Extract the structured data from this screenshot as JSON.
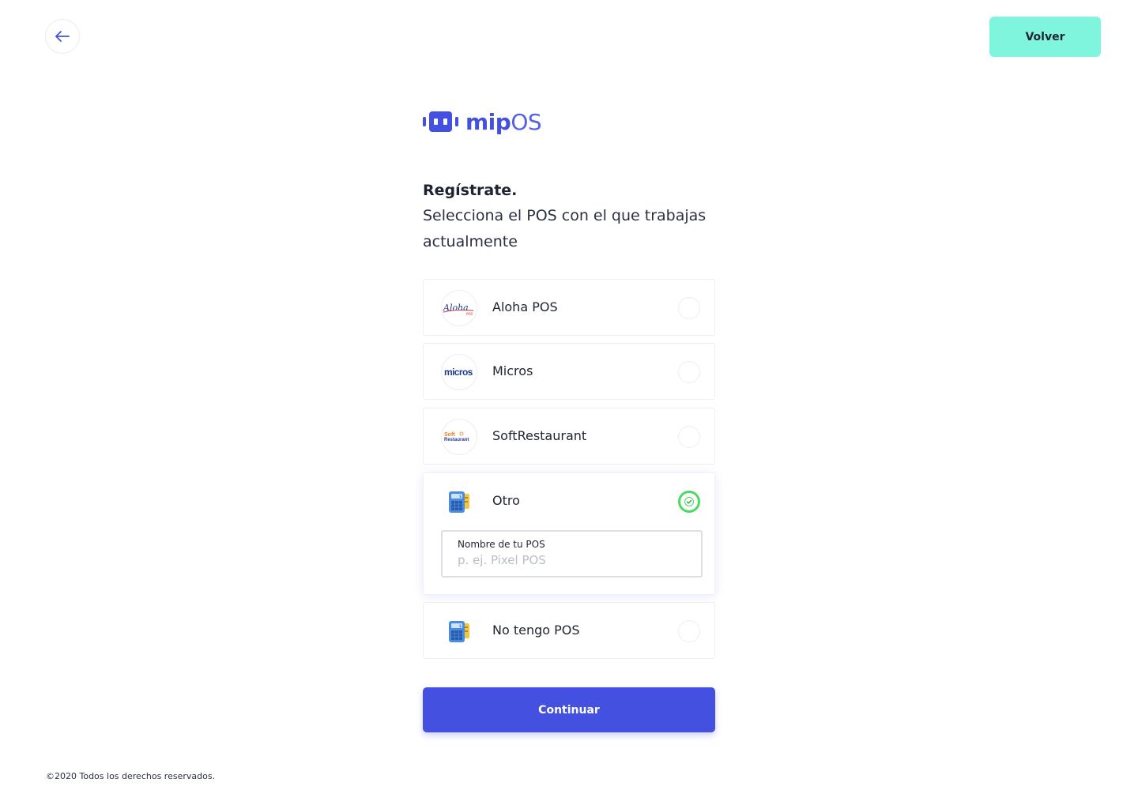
{
  "header": {
    "back_icon": "arrow-left-icon",
    "volver_label": "Volver"
  },
  "brand": {
    "logo_icon": "pos-terminal-icon",
    "name_bold": "mip",
    "name_light": "OS"
  },
  "heading": {
    "title": "Regístrate.",
    "subtitle": "Selecciona el POS con el que trabajas actualmente"
  },
  "options": [
    {
      "label": "Aloha POS",
      "logo_text": "Aloha",
      "logo_subtext": "POS",
      "selected": false
    },
    {
      "label": "Micros",
      "logo_text": "micros",
      "selected": false
    },
    {
      "label": "SoftRestaurant",
      "logo_text": "Soft",
      "logo_subtext": "Restaurant",
      "selected": false
    },
    {
      "label": "Otro",
      "logo_icon": "cash-register-icon",
      "selected": true
    },
    {
      "label": "No tengo POS",
      "logo_icon": "cash-register-icon",
      "selected": false
    }
  ],
  "pos_field": {
    "label": "Nombre de tu POS",
    "placeholder": "p. ej. Pixel POS",
    "value": ""
  },
  "continue_label": "Continuar",
  "footer": {
    "copyright": "©2020 Todos los derechos reservados."
  },
  "colors": {
    "primary": "#4350e0",
    "accent": "#7ef5dc",
    "success": "#4cd964",
    "text": "#1e2330"
  }
}
